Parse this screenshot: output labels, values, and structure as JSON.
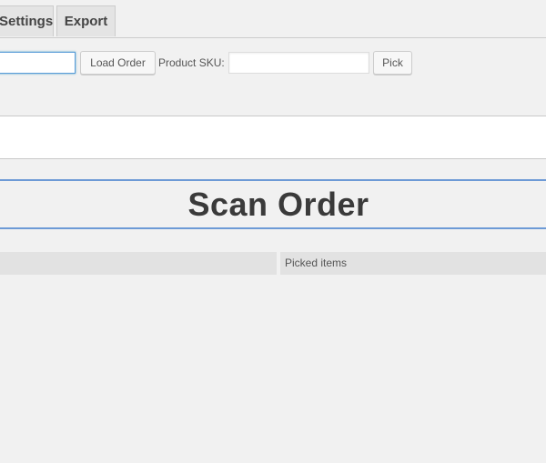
{
  "tabs": [
    {
      "label": "Settings"
    },
    {
      "label": "Export"
    }
  ],
  "toolbar": {
    "order_input_value": "",
    "load_order_label": "Load Order",
    "sku_label": "Product SKU:",
    "sku_input_value": "",
    "pick_label": "Pick"
  },
  "scan": {
    "title": "Scan Order"
  },
  "columns": {
    "left_header": "",
    "right_header": "Picked items"
  },
  "colors": {
    "accent": "#6d9ad6",
    "focus_border": "#5b9dd9",
    "background": "#f1f1f1"
  }
}
